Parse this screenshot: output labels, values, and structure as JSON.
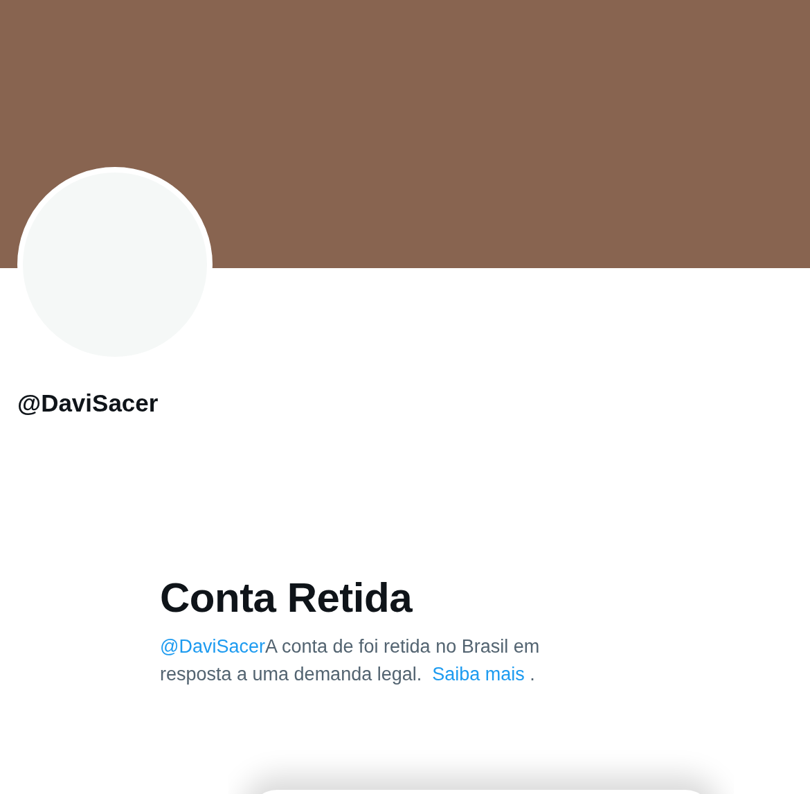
{
  "profile": {
    "handle": "@DaviSacer"
  },
  "notice": {
    "title": "Conta Retida",
    "handle_link": "@DaviSacer",
    "text": "A conta de foi retida no Brasil em resposta a uma demanda legal.",
    "link": "Saiba mais",
    "end": "."
  }
}
